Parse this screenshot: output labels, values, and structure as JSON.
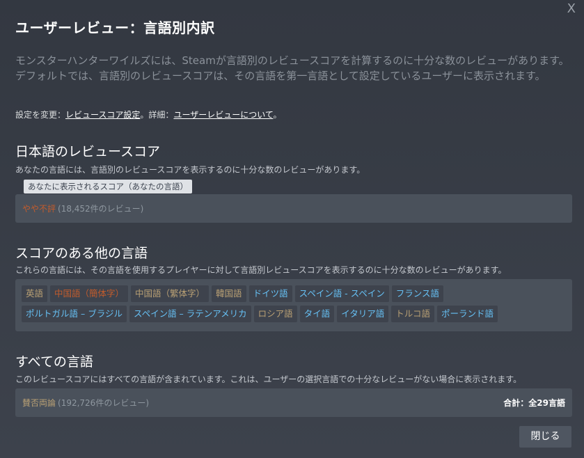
{
  "dialog": {
    "close_glyph": "X",
    "title": "ユーザーレビュー：言語別内訳",
    "description": "モンスターハンターワイルズには、Steamが言語別のレビュースコアを計算するのに十分な数のレビューがあります。デフォルトでは、言語別のレビュースコアは、その言語を第一言語として設定しているユーザーに表示されます。",
    "settings_prefix": "設定を変更：",
    "settings_link": "レビュースコア設定",
    "details_prefix": "。詳細：",
    "details_link": "ユーザーレビューについて",
    "details_suffix": "。",
    "close_button": "閉じる"
  },
  "own_language": {
    "title": "日本語のレビュースコア",
    "subtitle": "あなたの言語には、言語別のレビュースコアを表示するのに十分な数のレビューがあります。",
    "tooltip": "あなたに表示されるスコア（あなたの言語）",
    "rating": "やや不評",
    "count": "(18,452件のレビュー)"
  },
  "other_languages": {
    "title": "スコアのある他の言語",
    "subtitle": "これらの言語には、その言語を使用するプレイヤーに対して言語別レビュースコアを表示するのに十分な数のレビューがあります。",
    "rows": [
      [
        {
          "label": "英語",
          "tone": "mixed"
        },
        {
          "label": "中国語（簡体字）",
          "tone": "negative"
        },
        {
          "label": "中国語（繁体字）",
          "tone": "mixed"
        },
        {
          "label": "韓国語",
          "tone": "mixed"
        },
        {
          "label": "ドイツ語",
          "tone": "positive"
        },
        {
          "label": "スペイン語 - スペイン",
          "tone": "positive"
        },
        {
          "label": "フランス語",
          "tone": "positive"
        }
      ],
      [
        {
          "label": "ポルトガル語 – ブラジル",
          "tone": "positive"
        },
        {
          "label": "スペイン語 – ラテンアメリカ",
          "tone": "positive"
        },
        {
          "label": "ロシア語",
          "tone": "mixed"
        },
        {
          "label": "タイ語",
          "tone": "positive"
        },
        {
          "label": "イタリア語",
          "tone": "positive"
        },
        {
          "label": "トルコ語",
          "tone": "mixed"
        },
        {
          "label": "ポーランド語",
          "tone": "positive"
        }
      ]
    ]
  },
  "all_languages": {
    "title": "すべての言語",
    "subtitle": "このレビュースコアにはすべての言語が含まれています。これは、ユーザーの選択言語での十分なレビューがない場合に表示されます。",
    "rating": "賛否両論",
    "count": "(192,726件のレビュー)",
    "total": "合計：全29言語"
  },
  "colors": {
    "positive": "#66c0f4",
    "mixed": "#b9a074",
    "negative": "#c35c2c"
  }
}
